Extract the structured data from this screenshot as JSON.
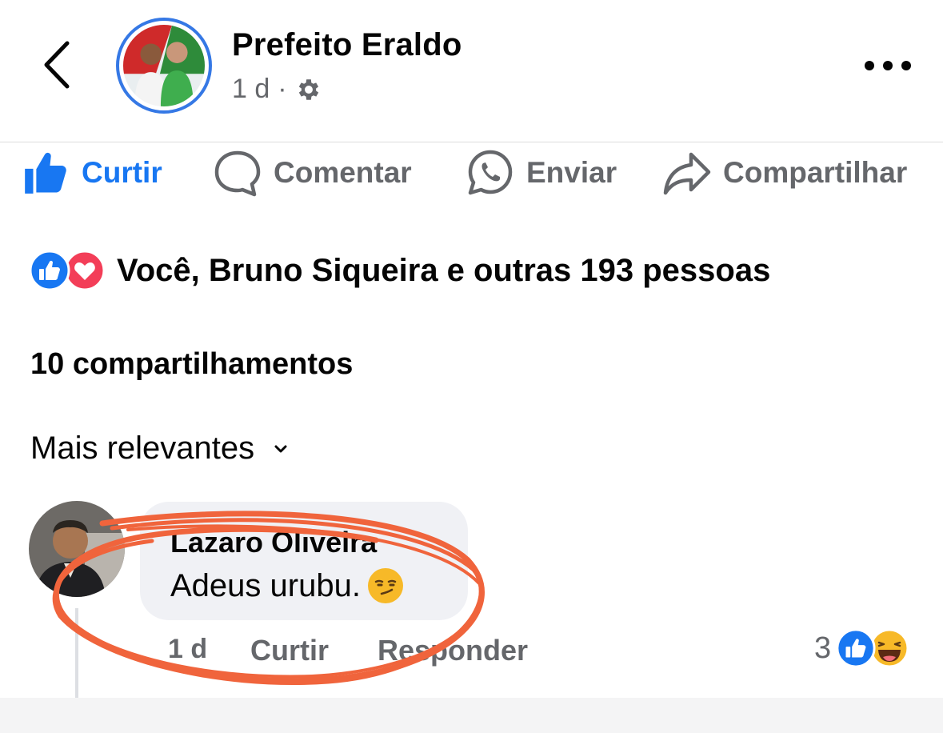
{
  "post": {
    "page_name": "Prefeito Eraldo",
    "time": "1 d",
    "separator": "·",
    "privacy_icon": "gear-icon"
  },
  "actions": {
    "like": "Curtir",
    "comment": "Comentar",
    "send": "Enviar",
    "share": "Compartilhar"
  },
  "reactions": {
    "icons": [
      "like-icon",
      "love-icon"
    ],
    "text": "Você, Bruno Siqueira e outras 193 pessoas"
  },
  "shares": "10 compartilhamentos",
  "sort": {
    "label": "Mais relevantes",
    "icon": "chevron-down-icon"
  },
  "comment": {
    "author": "Lazaro Oliveira",
    "text": "Adeus urubu.",
    "emoji": "smirk-emoji",
    "time": "1 d",
    "like_label": "Curtir",
    "reply_label": "Responder",
    "reaction_count": "3",
    "reaction_icons": [
      "like-icon",
      "haha-icon"
    ]
  },
  "colors": {
    "accent": "#1877f2",
    "secondary_text": "#65676b",
    "love": "#f33e58",
    "annotation": "#f0643c"
  }
}
